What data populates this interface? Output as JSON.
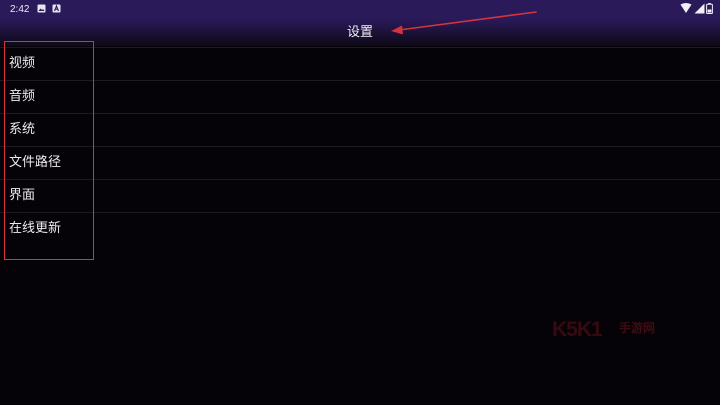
{
  "status_bar": {
    "time": "2:42",
    "left_icons": [
      "image-icon",
      "a-notification-icon"
    ],
    "right_icons": [
      "wifi-icon",
      "signal-icon",
      "battery-icon"
    ]
  },
  "header": {
    "title": "设置"
  },
  "settings": {
    "items": [
      {
        "label": "视频"
      },
      {
        "label": "音频"
      },
      {
        "label": "系统"
      },
      {
        "label": "文件路径"
      },
      {
        "label": "界面"
      },
      {
        "label": "在线更新"
      }
    ]
  },
  "watermark": {
    "logo": "K5K1",
    "text": "手游网"
  },
  "colors": {
    "status_bar": "#2a1a5a",
    "background": "#050307",
    "annotation": "#d6333c"
  }
}
